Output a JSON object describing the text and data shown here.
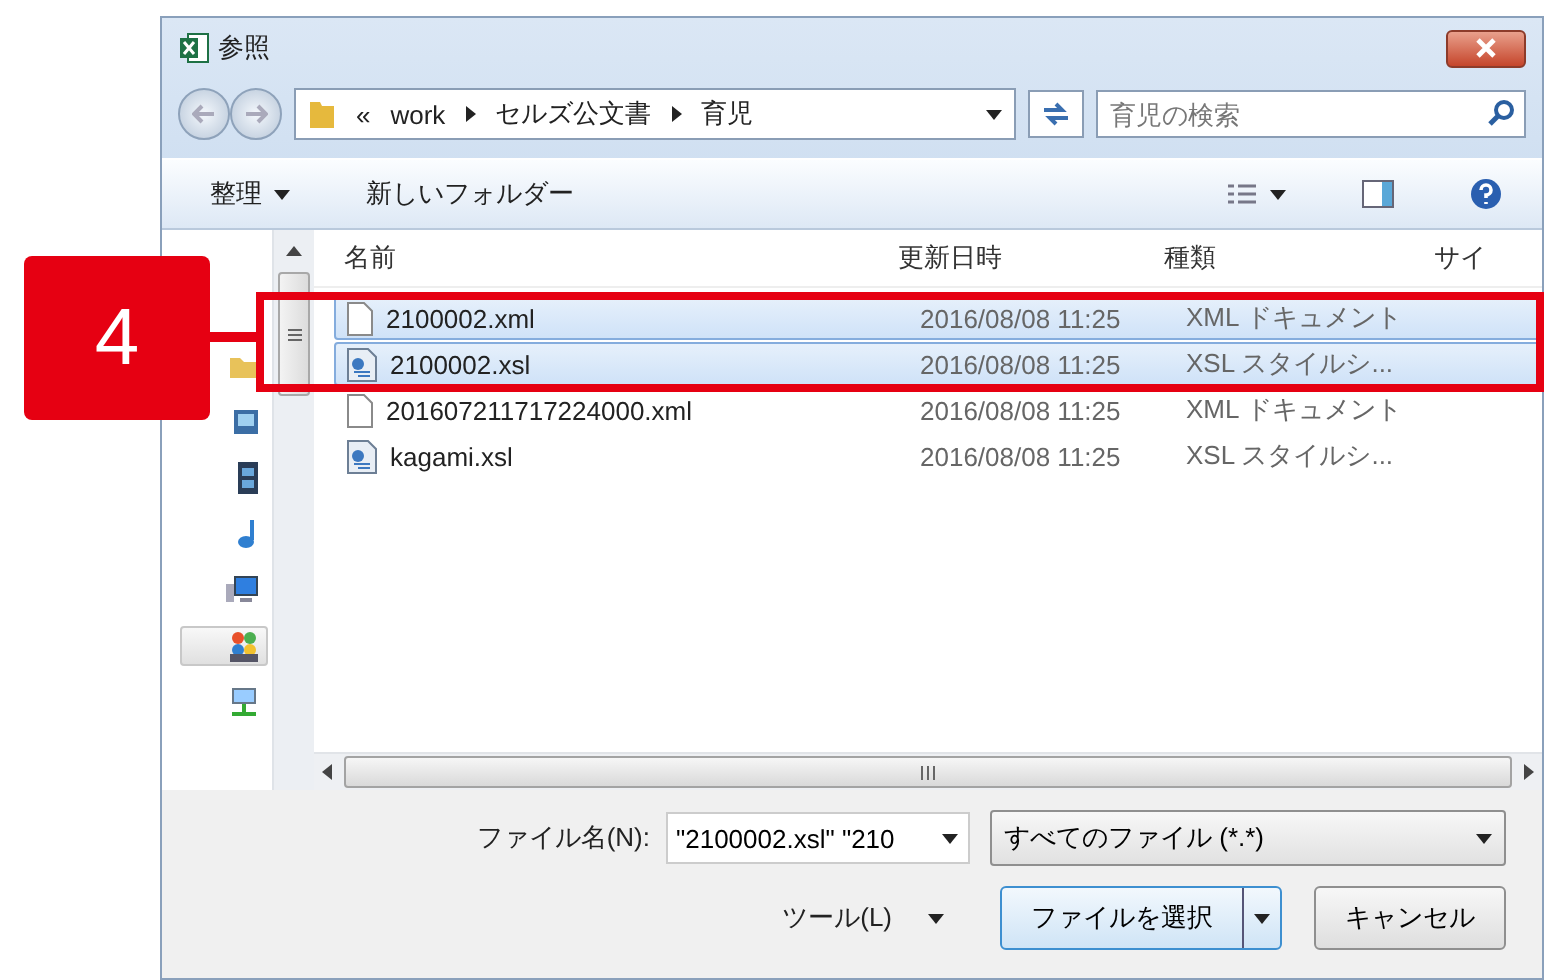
{
  "window": {
    "title": "参照"
  },
  "address": {
    "overflow": "«",
    "path": [
      "work",
      "セルズ公文書",
      "育児"
    ]
  },
  "search": {
    "placeholder": "育児の検索"
  },
  "toolbar": {
    "organize": "整理",
    "new_folder": "新しいフォルダー"
  },
  "nav": [
    {
      "kind": "folder",
      "selected": false
    },
    {
      "kind": "picture",
      "selected": false
    },
    {
      "kind": "video",
      "selected": false
    },
    {
      "kind": "music",
      "selected": false
    },
    {
      "kind": "computer",
      "selected": false
    },
    {
      "kind": "homegroup",
      "selected": true
    },
    {
      "kind": "network",
      "selected": false
    }
  ],
  "columns": [
    "名前",
    "更新日時",
    "種類",
    "サイ"
  ],
  "rows": [
    {
      "kind": "xml",
      "name": "2100002.xml",
      "date": "2016/08/08 11:25",
      "type": "XML ドキュメント",
      "selected": true
    },
    {
      "kind": "xsl",
      "name": "2100002.xsl",
      "date": "2016/08/08 11:25",
      "type": "XSL スタイルシ...",
      "selected": true
    },
    {
      "kind": "xml",
      "name": "201607211717224000.xml",
      "date": "2016/08/08 11:25",
      "type": "XML ドキュメント",
      "selected": false
    },
    {
      "kind": "xsl",
      "name": "kagami.xsl",
      "date": "2016/08/08 11:25",
      "type": "XSL スタイルシ...",
      "selected": false
    }
  ],
  "filename": {
    "label": "ファイル名(N):",
    "value": "\"2100002.xsl\" \"210"
  },
  "filter": {
    "value": "すべてのファイル (*.*)"
  },
  "tools": "ツール(L)",
  "buttons": {
    "open": "ファイルを選択",
    "cancel": "キャンセル"
  },
  "callout": {
    "number": "4"
  }
}
